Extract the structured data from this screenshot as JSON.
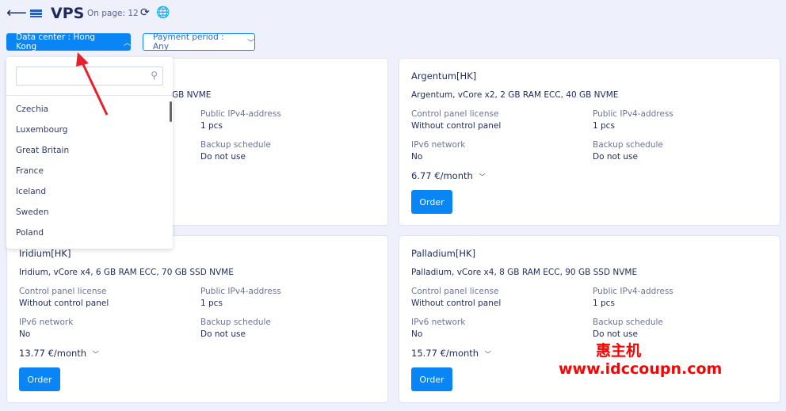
{
  "header": {
    "title": "VPS",
    "on_page": "On page: 12"
  },
  "filters": {
    "data_center": "Data center : Hong Kong",
    "payment_period": "Payment period : Any"
  },
  "dropdown": {
    "search_placeholder": "",
    "items": [
      "Czechia",
      "Luxembourg",
      "Great Britain",
      "France",
      "Iceland",
      "Sweden",
      "Poland"
    ]
  },
  "labels": {
    "cp": "Control panel license",
    "ipv4": "Public IPv4-address",
    "ipv6": "IPv6 network",
    "backup": "Backup schedule",
    "order": "Order"
  },
  "card0": {
    "desc_partial": "GB NVME",
    "ipv4": "1 pcs",
    "backup": "Do not use"
  },
  "cards": [
    {
      "title": "Argentum[HK]",
      "desc": "Argentum, vCore x2, 2 GB RAM ECC, 40 GB NVME",
      "cp": "Without control panel",
      "ipv4": "1 pcs",
      "ipv6": "No",
      "backup": "Do not use",
      "price": "6.77 €/month"
    },
    {
      "title": "Iridium[HK]",
      "desc": "Iridium, vCore x4, 6 GB RAM ECC, 70 GB SSD NVME",
      "cp": "Without control panel",
      "ipv4": "1 pcs",
      "ipv6": "No",
      "backup": "Do not use",
      "price": "13.77 €/month"
    },
    {
      "title": "Palladium[HK]",
      "desc": "Palladium, vCore x4, 8 GB RAM ECC, 90 GB SSD NVME",
      "cp": "Without control panel",
      "ipv4": "1 pcs",
      "ipv6": "No",
      "backup": "Do not use",
      "price": "15.77 €/month"
    }
  ],
  "watermark": {
    "line1": "惠主机",
    "line2": "www.idccoupn.com"
  },
  "colors": {
    "accent": "#0a85f5",
    "background": "#eef1fc",
    "annotation": "#e8202a"
  }
}
